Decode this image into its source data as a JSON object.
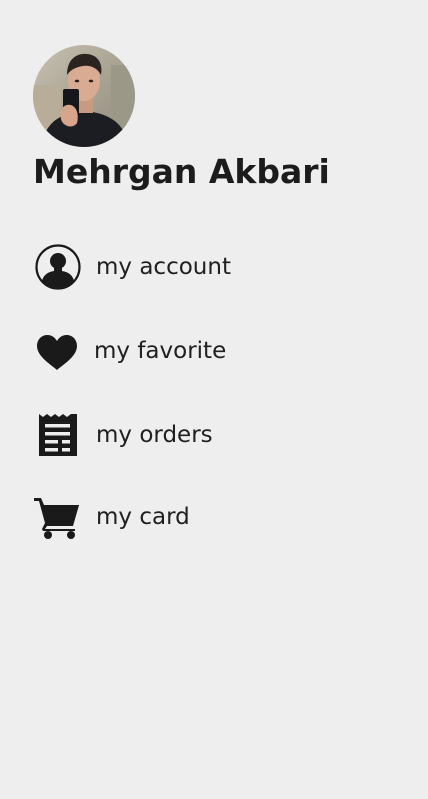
{
  "user": {
    "name": "Mehrgan Akbari",
    "avatar_icon": "profile-photo"
  },
  "menu": {
    "items": [
      {
        "label": "my account",
        "icon": "account-circle-icon"
      },
      {
        "label": "my favorite",
        "icon": "heart-icon"
      },
      {
        "label": "my orders",
        "icon": "receipt-icon"
      },
      {
        "label": "my card",
        "icon": "shopping-cart-icon"
      }
    ]
  },
  "colors": {
    "background": "#eeeeee",
    "text": "#1e1e1e",
    "icon": "#1a1a1a"
  }
}
